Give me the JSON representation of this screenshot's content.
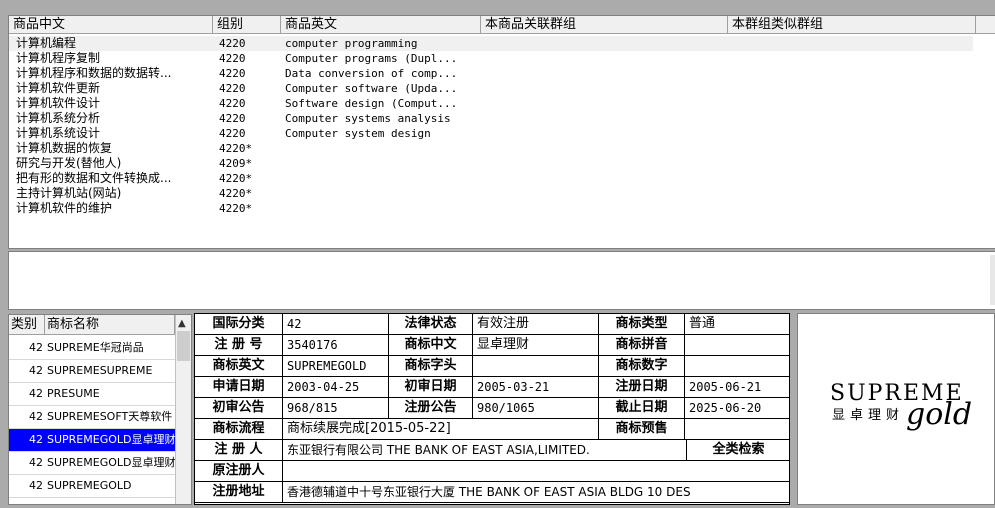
{
  "goods_table": {
    "headers": [
      "商品中文",
      "组别",
      "商品英文",
      "本商品关联群组",
      "本群组类似群组"
    ],
    "rows": [
      {
        "cn": "计算机编程",
        "group": "4220",
        "en": "computer programming"
      },
      {
        "cn": "计算机程序复制",
        "group": "4220",
        "en": "Computer programs (Dupl..."
      },
      {
        "cn": "计算机程序和数据的数据转...",
        "group": "4220",
        "en": "Data conversion of comp..."
      },
      {
        "cn": "计算机软件更新",
        "group": "4220",
        "en": "Computer software (Upda..."
      },
      {
        "cn": "计算机软件设计",
        "group": "4220",
        "en": "Software design (Comput..."
      },
      {
        "cn": "计算机系统分析",
        "group": "4220",
        "en": "Computer systems analysis"
      },
      {
        "cn": "计算机系统设计",
        "group": "4220",
        "en": "Computer system design"
      },
      {
        "cn": "计算机数据的恢复",
        "group": "4220*",
        "en": ""
      },
      {
        "cn": "研究与开发(替他人)",
        "group": "4209*",
        "en": ""
      },
      {
        "cn": "把有形的数据和文件转换成...",
        "group": "4220*",
        "en": ""
      },
      {
        "cn": "主持计算机站(网站)",
        "group": "4220*",
        "en": ""
      },
      {
        "cn": "计算机软件的维护",
        "group": "4220*",
        "en": ""
      }
    ]
  },
  "mark_list": {
    "headers": [
      "类别",
      "商标名称"
    ],
    "rows": [
      {
        "cls": "42",
        "name": "SUPREME华冠尚品"
      },
      {
        "cls": "42",
        "name": "SUPREMESUPREME"
      },
      {
        "cls": "42",
        "name": "PRESUME"
      },
      {
        "cls": "42",
        "name": "SUPREMESOFT天尊软件"
      },
      {
        "cls": "42",
        "name": "SUPREMEGOLD显卓理财"
      },
      {
        "cls": "42",
        "name": "SUPREMEGOLD显卓理财"
      },
      {
        "cls": "42",
        "name": "SUPREMEGOLD"
      }
    ],
    "selected_index": 4
  },
  "detail": {
    "intl_class_label": "国际分类",
    "intl_class": "42",
    "legal_status_label": "法律状态",
    "legal_status": "有效注册",
    "mark_type_label": "商标类型",
    "mark_type": "普通",
    "reg_no_label": "注 册 号",
    "reg_no": "3540176",
    "mark_cn_label": "商标中文",
    "mark_cn": "显卓理财",
    "pinyin_label": "商标拼音",
    "pinyin": "",
    "mark_en_label": "商标英文",
    "mark_en": "SUPREMEGOLD",
    "mark_letter_label": "商标字头",
    "mark_letter": "",
    "mark_digit_label": "商标数字",
    "mark_digit": "",
    "apply_date_label": "申请日期",
    "apply_date": "2003-04-25",
    "prelim_date_label": "初审日期",
    "prelim_date": "2005-03-21",
    "reg_date_label": "注册日期",
    "reg_date": "2005-06-21",
    "prelim_notice_label": "初审公告",
    "prelim_notice": "968/815",
    "reg_notice_label": "注册公告",
    "reg_notice": "980/1065",
    "expiry_label": "截止日期",
    "expiry": "2025-06-20",
    "process_label": "商标流程",
    "process": "商标续展完成[2015-05-22]",
    "warning_label": "商标预售",
    "warning": "",
    "registrant_label": "注 册 人",
    "registrant": "东亚银行有限公司 THE BANK OF EAST ASIA,LIMITED.",
    "full_search_label": "全类检索",
    "orig_registrant_label": "原注册人",
    "orig_registrant": "",
    "address_label": "注册地址",
    "address": "香港德辅道中十号东亚银行大厦 THE BANK OF EAST ASIA BLDG 10 DES"
  },
  "logo": {
    "word": "SUPREME",
    "cn": "显卓理财",
    "script": "gold"
  }
}
